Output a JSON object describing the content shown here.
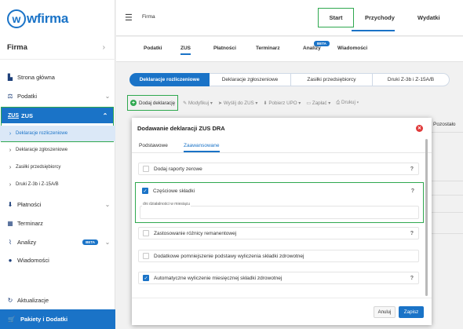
{
  "logo": {
    "mark": "w",
    "text": "wfirma"
  },
  "sidebar": {
    "header": "Firma",
    "items": [
      {
        "icon": "home-icon",
        "glyph": "▙",
        "label": "Strona główna"
      },
      {
        "icon": "taxes-icon",
        "glyph": "⚖",
        "label": "Podatki"
      },
      {
        "icon": "zus-icon",
        "glyph": "ZUS",
        "label": "ZUS"
      },
      {
        "icon": "payments-icon",
        "glyph": "⬇",
        "label": "Płatności"
      },
      {
        "icon": "calendar-icon",
        "glyph": "▦",
        "label": "Terminarz"
      },
      {
        "icon": "analytics-icon",
        "glyph": "⌇",
        "label": "Analizy"
      },
      {
        "icon": "messages-icon",
        "glyph": "●",
        "label": "Wiadomości"
      },
      {
        "icon": "updates-icon",
        "glyph": "↻",
        "label": "Aktualizacje"
      }
    ],
    "zus_sub": [
      "Deklaracje rozliczeniowe",
      "Deklaracje zgłoszeniowe",
      "Zasiłki przedsiębiorcy",
      "Druki Z-3b i Z-15A/B"
    ],
    "beta": "BETA",
    "bottom": {
      "glyph": "🛒",
      "label": "Pakiety i Dodatki"
    }
  },
  "topbar": {
    "title": "Firma",
    "nav": [
      "Start",
      "Przychody",
      "Wydatki"
    ]
  },
  "subnav": [
    "Podatki",
    "ZUS",
    "Płatności",
    "Terminarz",
    "Analizy",
    "Wiadomości"
  ],
  "page_tabs": [
    "Deklaracje rozliczeniowe",
    "Deklaracje zgłoszeniowe",
    "Zasiłki przedsiębiorcy",
    "Druki Z-3b i Z-15A/B"
  ],
  "actions": {
    "add": "Dodaj deklarację",
    "others": [
      "✎ Modyfikuj ▾",
      "➤ Wyślij do ZUS ▾",
      "⬇ Pobierz UPO ▾",
      "▭ Zapłać ▾",
      "⎙ Drukuj ▾"
    ]
  },
  "table": {
    "col": "Pozostało"
  },
  "modal": {
    "title": "Dodawanie deklaracji ZUS DRA",
    "tabs": [
      "Podstawowe",
      "Zaawansowane"
    ],
    "options": [
      {
        "label": "Dodaj raporty zerowe",
        "checked": false,
        "help": "?"
      },
      {
        "label": "Częściowe składki",
        "checked": true,
        "help": "?"
      },
      {
        "label": "Zastosowanie różnicy remanentowej",
        "checked": false,
        "help": "?"
      },
      {
        "label": "Dodatkowe pomniejszenie podstawy wyliczenia składki zdrowotnej",
        "checked": false,
        "help": ""
      },
      {
        "label": "Automatyczne wyliczenie miesięcznej składki zdrowotnej",
        "checked": true,
        "help": "?"
      }
    ],
    "field_label": "dni działalności w miesiącu",
    "cancel": "Anuluj",
    "save": "Zapisz"
  }
}
